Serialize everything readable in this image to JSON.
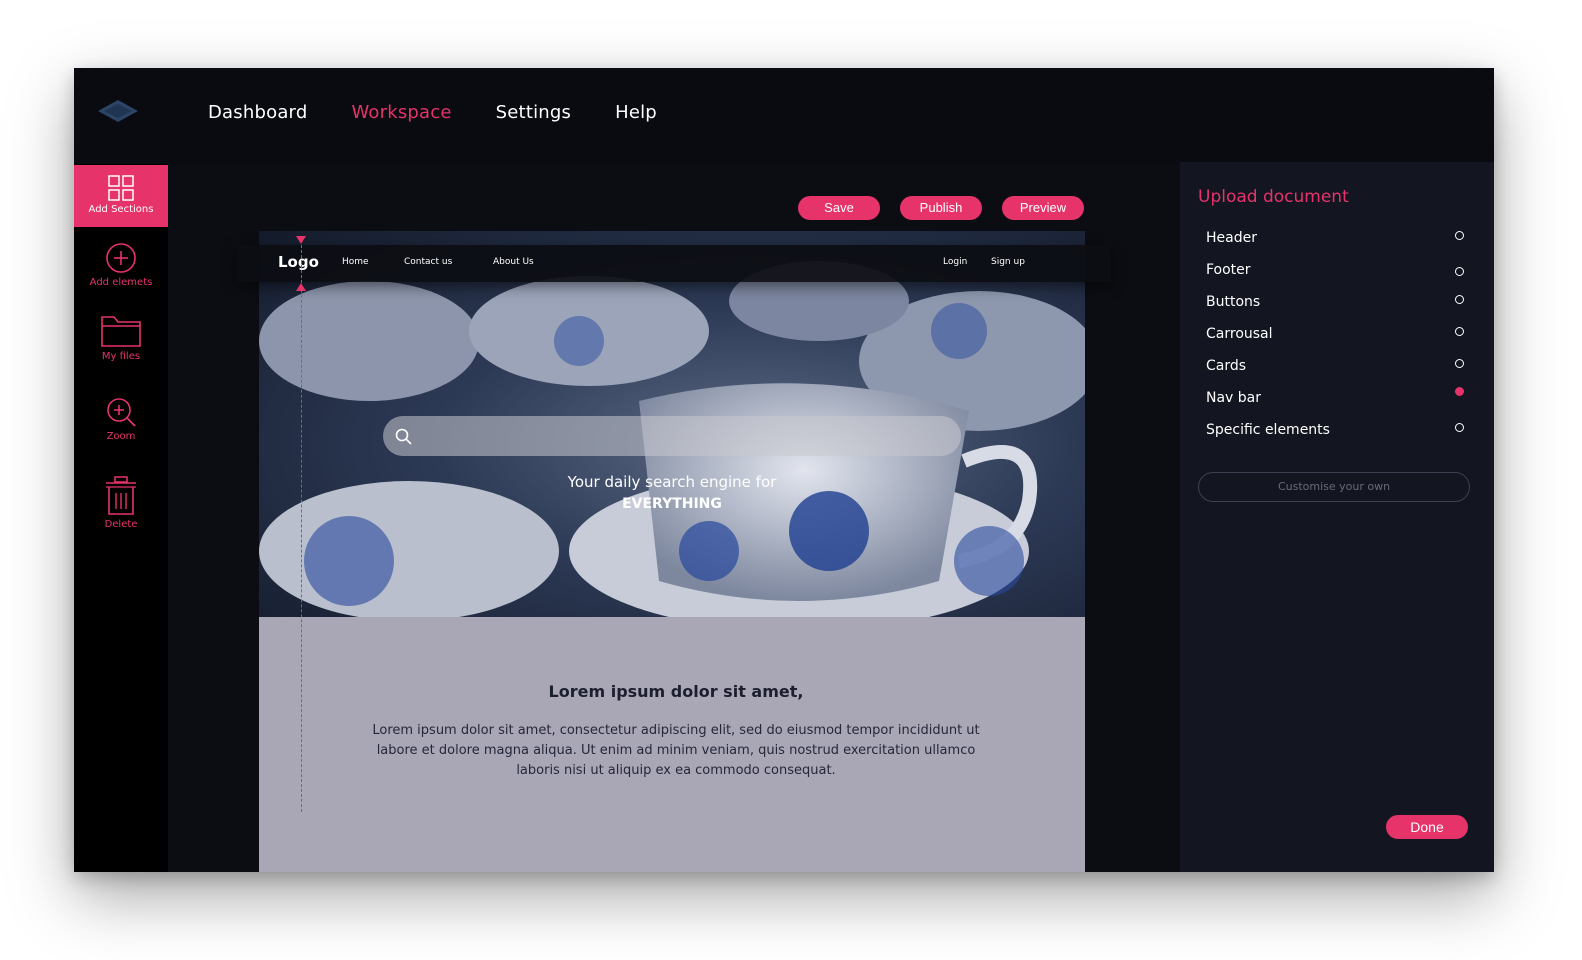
{
  "colors": {
    "accent": "#e6336a",
    "background": "#090b10",
    "panel": "#131620",
    "page": "#a9a6b6"
  },
  "topnav": {
    "logo_icon": "layers-icon",
    "items": [
      {
        "label": "Dashboard",
        "active": false
      },
      {
        "label": "Workspace",
        "active": true
      },
      {
        "label": "Settings",
        "active": false
      },
      {
        "label": "Help",
        "active": false
      }
    ]
  },
  "sidebar": {
    "items": [
      {
        "label": "Add Sections",
        "icon": "grid-icon",
        "active": true
      },
      {
        "label": "Add elemets",
        "icon": "plus-circle-icon",
        "active": false
      },
      {
        "label": "My files",
        "icon": "folder-icon",
        "active": false
      },
      {
        "label": "Zoom",
        "icon": "zoom-in-icon",
        "active": false
      },
      {
        "label": "Delete",
        "icon": "trash-icon",
        "active": false
      }
    ]
  },
  "toolbar": {
    "save": "Save",
    "publish": "Publish",
    "preview": "Preview"
  },
  "site": {
    "logo": "Logo",
    "links": {
      "home": "Home",
      "contact": "Contact us",
      "about": "About Us",
      "login": "Login",
      "signup": "Sign up"
    },
    "hero_line1": "Your daily search engine for",
    "hero_line2": "EVERYTHING",
    "content_title": "Lorem ipsum dolor sit amet,",
    "content_body": "Lorem ipsum dolor sit amet, consectetur adipiscing elit, sed do eiusmod tempor incididunt ut labore et dolore magna aliqua. Ut enim ad minim veniam, quis nostrud exercitation ullamco laboris nisi ut aliquip ex ea commodo consequat."
  },
  "panel": {
    "title": "Upload document",
    "items": [
      {
        "label": "Header",
        "checked": false
      },
      {
        "label": "Footer",
        "checked": false
      },
      {
        "label": "Buttons",
        "checked": false
      },
      {
        "label": "Carrousal",
        "checked": false
      },
      {
        "label": "Cards",
        "checked": false
      },
      {
        "label": "Nav bar",
        "checked": true
      },
      {
        "label": "Specific elements",
        "checked": false
      }
    ],
    "customise": "Customise your own",
    "done": "Done"
  }
}
